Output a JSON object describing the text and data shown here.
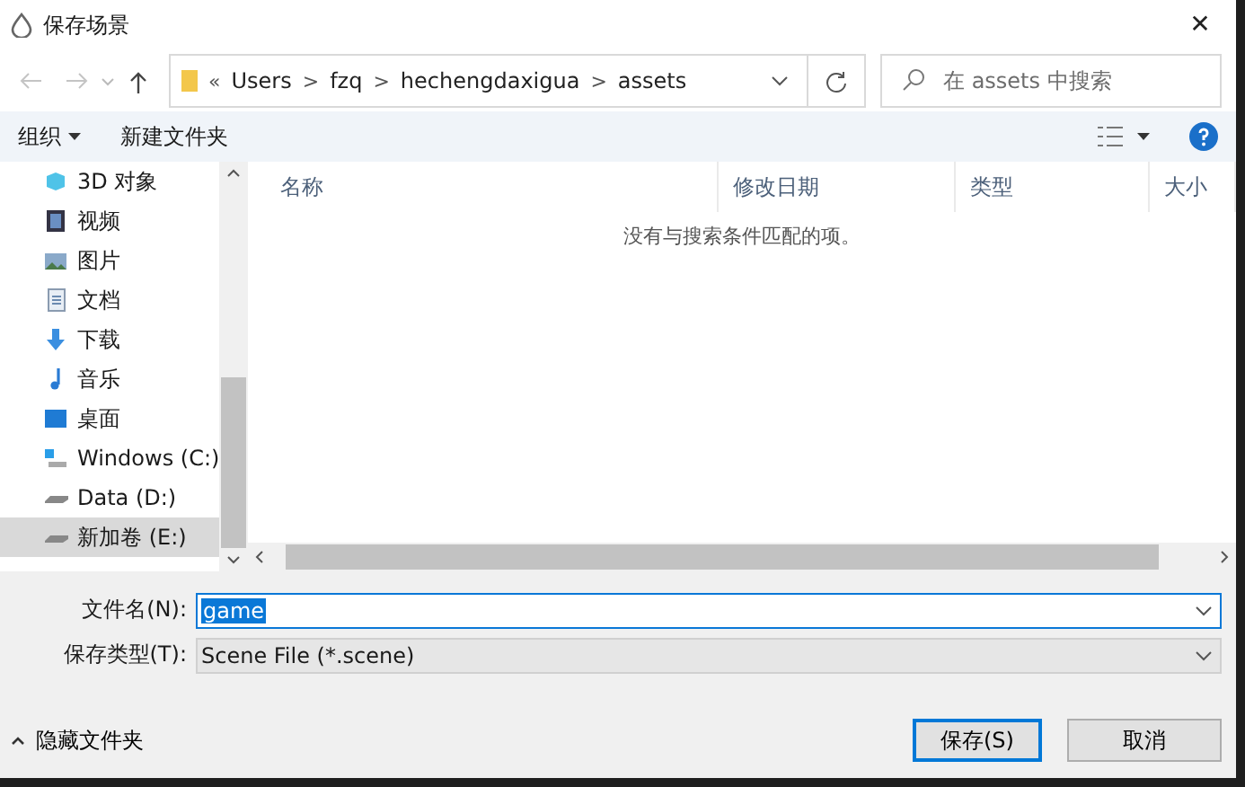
{
  "window": {
    "title": "保存场景",
    "close": "✕"
  },
  "address": {
    "overflow": "«",
    "separator": ">",
    "crumbs": [
      "Users",
      "fzq",
      "hechengdaxigua",
      "assets"
    ]
  },
  "search": {
    "placeholder": "在 assets 中搜索"
  },
  "toolbar": {
    "organize": "组织",
    "new_folder": "新建文件夹"
  },
  "nav": [
    {
      "label": "3D 对象",
      "kind": "cube",
      "selected": false
    },
    {
      "label": "视频",
      "kind": "video",
      "selected": false
    },
    {
      "label": "图片",
      "kind": "image",
      "selected": false
    },
    {
      "label": "文档",
      "kind": "doc",
      "selected": false
    },
    {
      "label": "下载",
      "kind": "download",
      "selected": false
    },
    {
      "label": "音乐",
      "kind": "music",
      "selected": false
    },
    {
      "label": "桌面",
      "kind": "desktop",
      "selected": false
    },
    {
      "label": "Windows (C:)",
      "kind": "windrive",
      "selected": false
    },
    {
      "label": "Data (D:)",
      "kind": "drive",
      "selected": false
    },
    {
      "label": "新加卷 (E:)",
      "kind": "drive",
      "selected": true
    }
  ],
  "columns": [
    "名称",
    "修改日期",
    "类型",
    "大小"
  ],
  "empty_message": "没有与搜索条件匹配的项。",
  "file_name": {
    "label": "文件名(N):",
    "value": "game"
  },
  "file_type": {
    "label": "保存类型(T):",
    "value": "Scene File (*.scene)"
  },
  "hide_folders": "隐藏文件夹",
  "buttons": [
    {
      "label": "保存(S)",
      "kind": "default"
    },
    {
      "label": "取消",
      "kind": "normal"
    }
  ]
}
